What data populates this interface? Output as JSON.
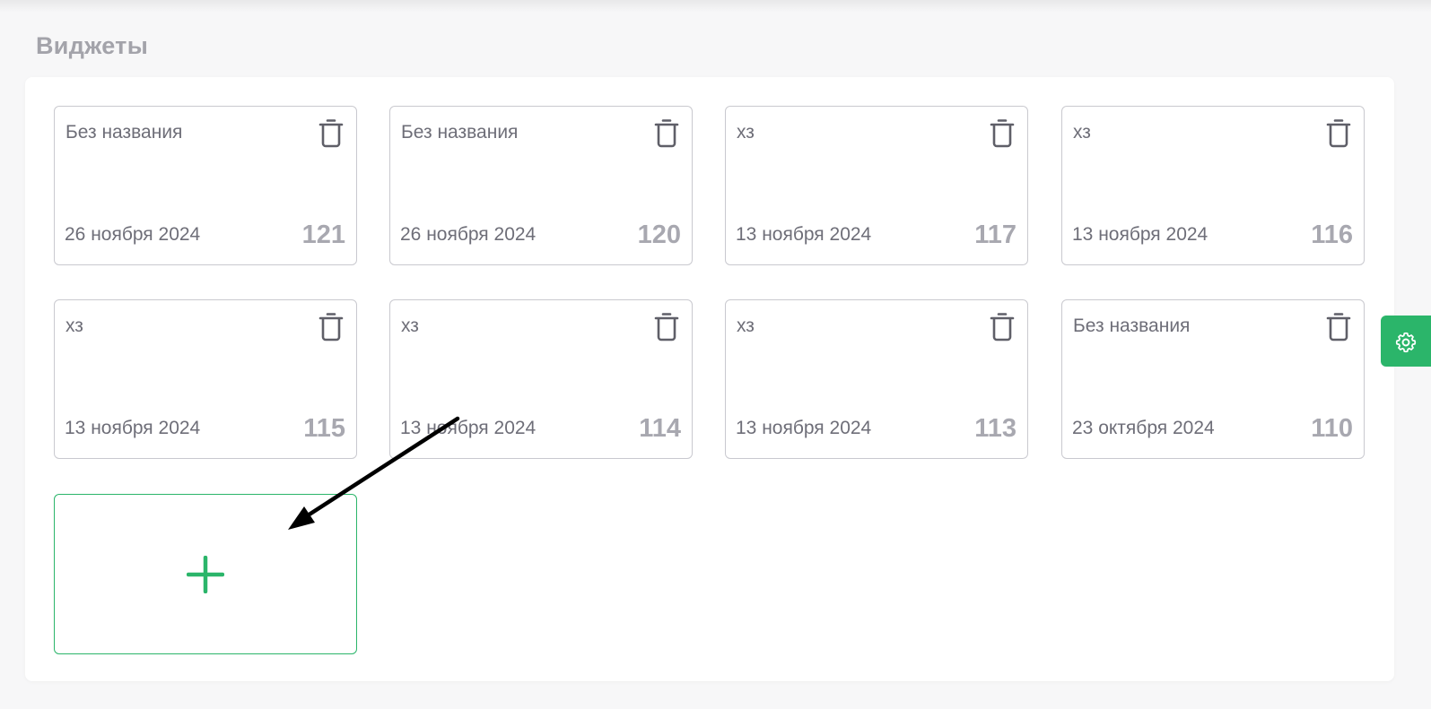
{
  "page": {
    "title": "Виджеты"
  },
  "widgets": [
    {
      "title": "Без названия",
      "date": "26 ноября 2024",
      "id": "121"
    },
    {
      "title": "Без названия",
      "date": "26 ноября 2024",
      "id": "120"
    },
    {
      "title": "хз",
      "date": "13 ноября 2024",
      "id": "117"
    },
    {
      "title": "хз",
      "date": "13 ноября 2024",
      "id": "116"
    },
    {
      "title": "хз",
      "date": "13 ноября 2024",
      "id": "115"
    },
    {
      "title": "хз",
      "date": "13 ноября 2024",
      "id": "114"
    },
    {
      "title": "хз",
      "date": "13 ноября 2024",
      "id": "113"
    },
    {
      "title": "Без названия",
      "date": "23 октября 2024",
      "id": "110"
    }
  ],
  "icons": {
    "delete": "trash-icon",
    "add": "plus-icon",
    "settings": "gear-icon",
    "annotation": "arrow-icon"
  },
  "colors": {
    "accent": "#2bb56a",
    "title_text": "#a3a3aa",
    "card_text": "#6e6e78",
    "card_id": "#a8a8b0",
    "card_border": "#c9c9cf",
    "icon": "#5f5f68"
  }
}
